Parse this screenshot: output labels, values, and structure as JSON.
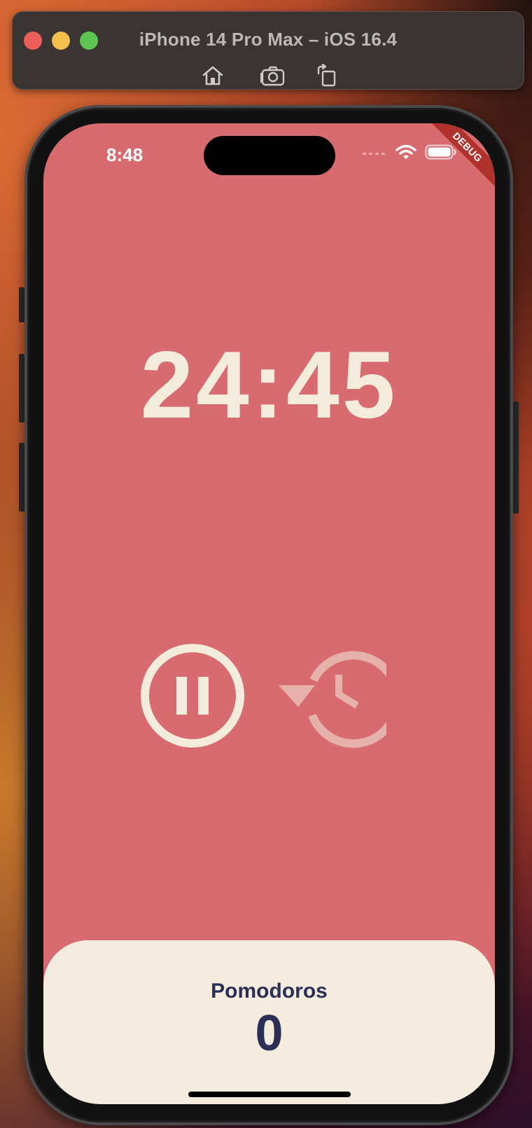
{
  "simulator": {
    "title": "iPhone 14 Pro Max – iOS 16.4",
    "toolbar": [
      "home-icon",
      "screenshot-icon",
      "rotate-icon"
    ]
  },
  "status_bar": {
    "time": "8:48",
    "icons": [
      "cellular-icon",
      "wifi-icon",
      "battery-icon"
    ]
  },
  "debug_banner": "DEBUG",
  "timer": {
    "display": "24:45"
  },
  "controls": {
    "pause_icon": "pause-circle-icon",
    "restart_icon": "restore-history-icon"
  },
  "pomodoros": {
    "label": "Pomodoros",
    "count": "0"
  },
  "colors": {
    "background": "#d86b70",
    "accent": "#f3ebdc",
    "card": "#f4ecde",
    "text_dark": "#2b2e55"
  }
}
